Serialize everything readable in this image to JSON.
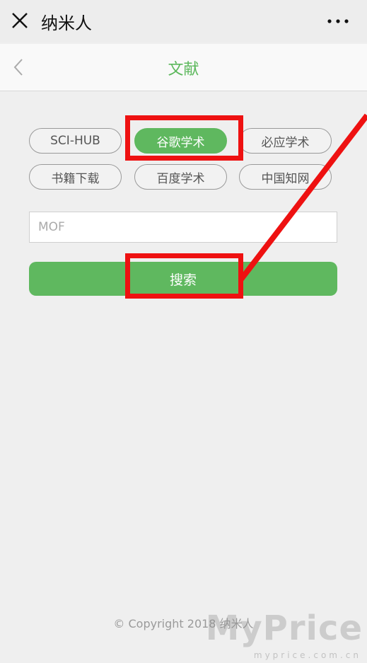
{
  "topbar": {
    "title": "纳米人"
  },
  "navbar": {
    "title": "文献"
  },
  "chips": [
    {
      "label": "SCI-HUB",
      "active": false
    },
    {
      "label": "谷歌学术",
      "active": true
    },
    {
      "label": "必应学术",
      "active": false
    },
    {
      "label": "书籍下载",
      "active": false
    },
    {
      "label": "百度学术",
      "active": false
    },
    {
      "label": "中国知网",
      "active": false
    }
  ],
  "search": {
    "value": "",
    "placeholder": "MOF",
    "button_label": "搜索"
  },
  "footer": {
    "copyright": "© Copyright 2018 纳米人"
  },
  "watermark": {
    "text": "MyPrice",
    "url": "myprice.com.cn"
  },
  "colors": {
    "accent": "#5fb85f",
    "annotation": "#ee1111"
  }
}
